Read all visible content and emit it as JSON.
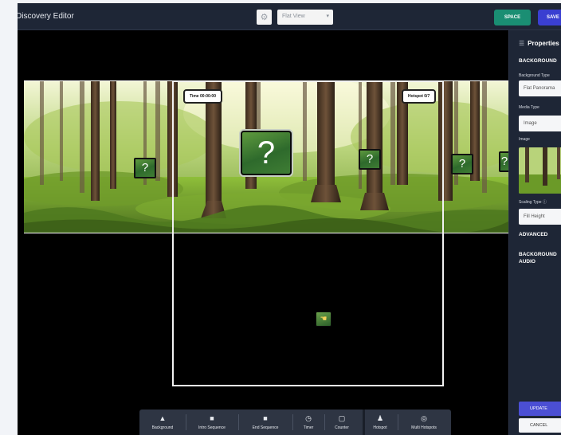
{
  "app": {
    "title": "Discovery Editor"
  },
  "topbar": {
    "settings_icon": "gear-icon",
    "view_select": {
      "value": "Flat View"
    },
    "space_label": "SPACE",
    "save_label": "SAVE"
  },
  "stage": {
    "timer_label": "Time 00:00:00",
    "hotspot_counter_label": "Hotspot 0/7",
    "hotspot_glyph": "?",
    "tiny_hotspot_icon": "hand-icon"
  },
  "properties": {
    "title": "Properties",
    "title_icon": "panel-icon",
    "background_section": "BACKGROUND",
    "background_type_label": "Background Type",
    "background_type_value": "Flat Panorama",
    "media_type_label": "Media Type",
    "media_type_value": "Image",
    "image_label": "Image",
    "scaling_type_label": "Scaling Type",
    "scaling_type_value": "Fill Height",
    "advanced_section": "ADVANCED",
    "background_audio_section_line1": "BACKGROUND",
    "background_audio_section_line2": "AUDIO",
    "update_label": "UPDATE",
    "cancel_label": "CANCEL"
  },
  "toolbar": {
    "items": [
      {
        "label": "Background",
        "icon": "mountain-icon",
        "glyph": "▲"
      },
      {
        "label": "Intro Sequence",
        "icon": "chat-icon",
        "glyph": "■"
      },
      {
        "label": "End Sequence",
        "icon": "chat-icon",
        "glyph": "■"
      },
      {
        "label": "Timer",
        "icon": "stopwatch-icon",
        "glyph": "◷"
      },
      {
        "label": "Counter",
        "icon": "counter-icon",
        "glyph": "▢"
      },
      {
        "label": "Hotspot",
        "icon": "hotspot-icon",
        "glyph": "♟"
      },
      {
        "label": "Multi Hotspots",
        "icon": "multi-hotspot-icon",
        "glyph": "◎"
      }
    ]
  }
}
